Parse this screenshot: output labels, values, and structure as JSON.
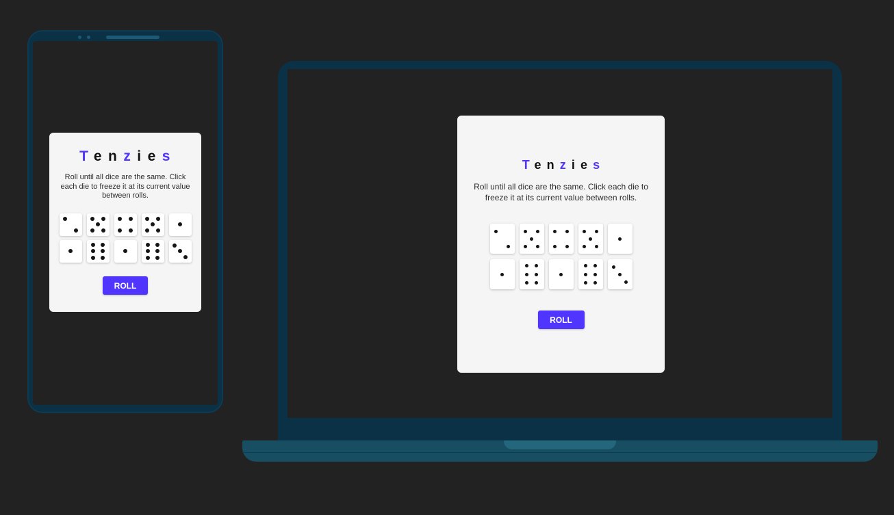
{
  "app": {
    "title_letters": [
      "T",
      "e",
      "n",
      "z",
      "i",
      "e",
      "s"
    ],
    "title_accent_indices": [
      0,
      3,
      6
    ],
    "instructions": "Roll until all dice are the same. Click each die to freeze it at its current value between rolls.",
    "roll_label": "ROLL",
    "accent_color": "#5035ff"
  },
  "phone": {
    "dice": [
      2,
      5,
      4,
      5,
      1,
      1,
      6,
      1,
      6,
      3
    ]
  },
  "laptop": {
    "dice": [
      2,
      5,
      4,
      5,
      1,
      1,
      6,
      1,
      6,
      3
    ]
  },
  "devices": [
    "phone-mockup",
    "laptop-mockup"
  ]
}
